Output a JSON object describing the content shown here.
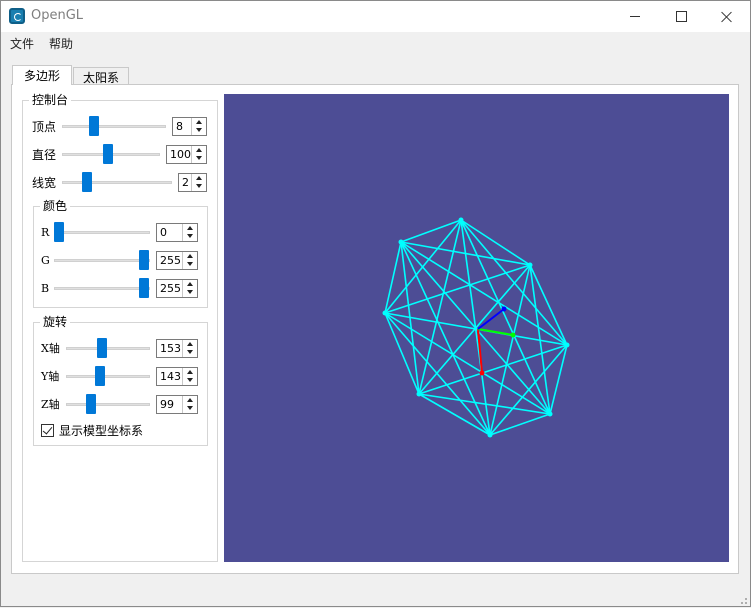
{
  "window": {
    "title": "OpenGL",
    "icon": "opengl-app-icon"
  },
  "menu": {
    "file": "文件",
    "help": "帮助"
  },
  "tabs": [
    {
      "label": "多边形",
      "active": true
    },
    {
      "label": "太阳系",
      "active": false
    }
  ],
  "console": {
    "title": "控制台",
    "vertices": {
      "label": "顶点",
      "value": "8"
    },
    "diameter": {
      "label": "直径",
      "value": "100"
    },
    "line_width": {
      "label": "线宽",
      "value": "2"
    },
    "color": {
      "title": "颜色",
      "r": {
        "label": "R",
        "value": "0"
      },
      "g": {
        "label": "G",
        "value": "255"
      },
      "b": {
        "label": "B",
        "value": "255"
      }
    },
    "rotation": {
      "title": "旋转",
      "x": {
        "label": "X轴",
        "value": "153"
      },
      "y": {
        "label": "Y轴",
        "value": "143"
      },
      "z": {
        "label": "Z轴",
        "value": "99"
      }
    },
    "show_axes": {
      "label": "显示模型坐标系",
      "checked": true
    }
  },
  "colors": {
    "viewport_bg": "#4d4d95",
    "polygon_lines": "#00ffff",
    "axis_x": "#ff0000",
    "axis_y": "#00ff00",
    "axis_z": "#0000ff",
    "slider_handle": "#0078d7"
  }
}
